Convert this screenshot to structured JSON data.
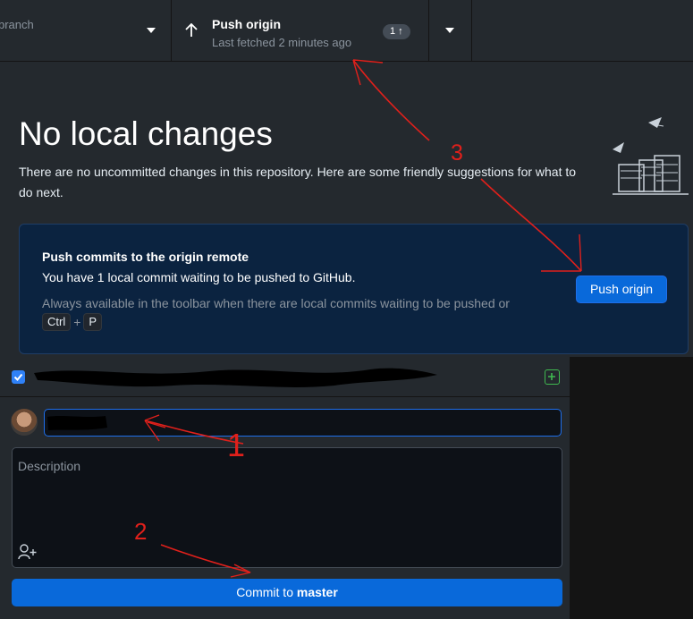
{
  "toolbar": {
    "branch_label": "branch",
    "push_title": "Push origin",
    "push_subtitle": "Last fetched 2 minutes ago",
    "push_badge": "1 ↑"
  },
  "main": {
    "heading": "No local changes",
    "lead": "There are no uncommitted changes in this repository. Here are some friendly suggestions for what to do next.",
    "card": {
      "title": "Push commits to the origin remote",
      "description": "You have 1 local commit waiting to be pushed to GitHub.",
      "hint": "Always available in the toolbar when there are local commits waiting to be pushed or",
      "shortcut_ctrl": "Ctrl",
      "shortcut_plus": "+",
      "shortcut_key": "P",
      "button": "Push origin"
    }
  },
  "commit": {
    "description_placeholder": "Description",
    "button_prefix": "Commit to ",
    "button_branch": "master"
  },
  "annotations": {
    "one": "1",
    "two": "2",
    "three": "3"
  },
  "colors": {
    "accent": "#0969da",
    "annotation": "#e0201b",
    "background": "#24292e",
    "card": "#0b2340"
  },
  "icons": [
    "caret-down-icon",
    "arrow-up-icon",
    "illustration-icon",
    "checkbox-icon",
    "plus-square-icon",
    "avatar",
    "coauthor-icon"
  ]
}
